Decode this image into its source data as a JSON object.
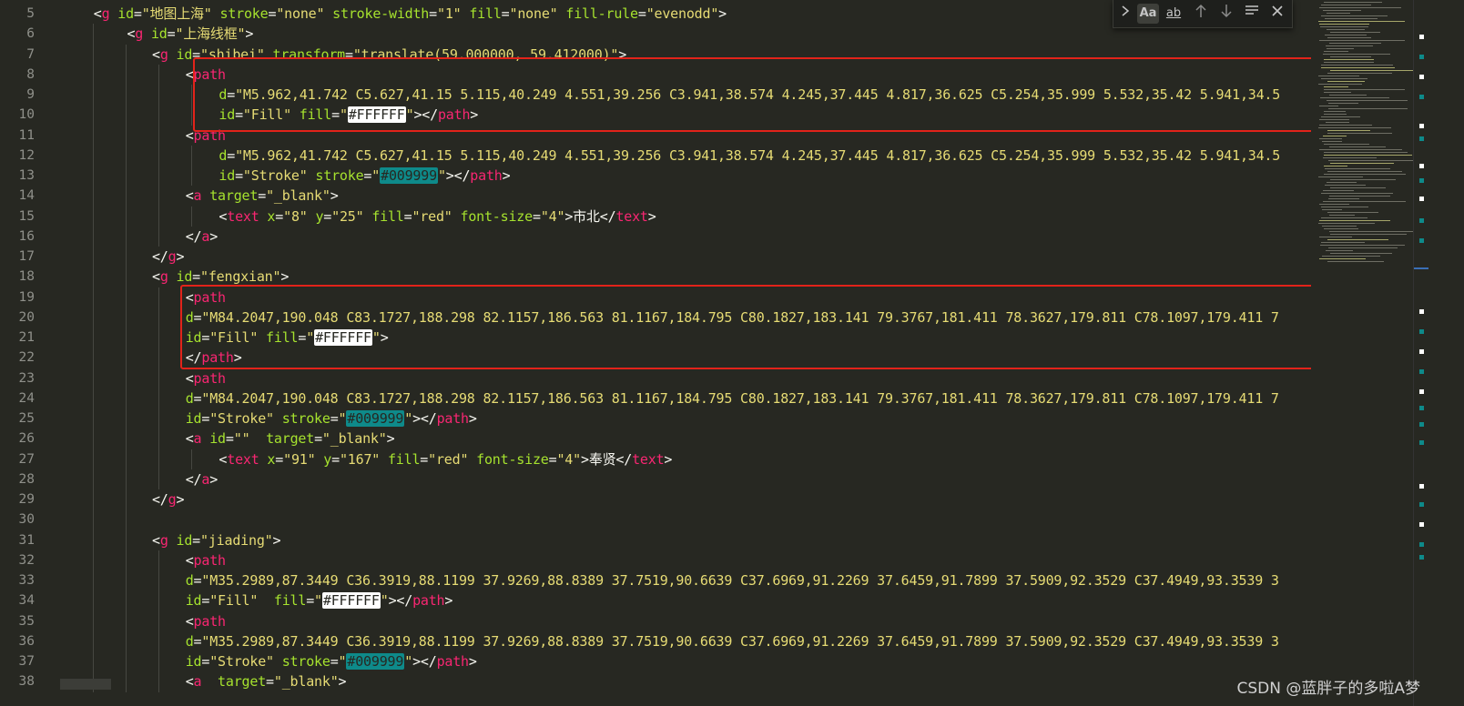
{
  "lines": [
    {
      "no": "5",
      "indent": "    ",
      "tokens": [
        [
          "p",
          "<"
        ],
        [
          "t",
          "g"
        ],
        [
          "c",
          " "
        ],
        [
          "a",
          "id"
        ],
        [
          "p",
          "="
        ],
        [
          "s",
          "\"地图上海\""
        ],
        [
          "c",
          " "
        ],
        [
          "a",
          "stroke"
        ],
        [
          "p",
          "="
        ],
        [
          "s",
          "\"none\""
        ],
        [
          "c",
          " "
        ],
        [
          "a",
          "stroke-width"
        ],
        [
          "p",
          "="
        ],
        [
          "s",
          "\"1\""
        ],
        [
          "c",
          " "
        ],
        [
          "a",
          "fill"
        ],
        [
          "p",
          "="
        ],
        [
          "s",
          "\"none\""
        ],
        [
          "c",
          " "
        ],
        [
          "a",
          "fill-rule"
        ],
        [
          "p",
          "="
        ],
        [
          "s",
          "\"evenodd\""
        ],
        [
          "p",
          ">"
        ]
      ]
    },
    {
      "no": "6",
      "indent": "        ",
      "tokens": [
        [
          "p",
          "<"
        ],
        [
          "t",
          "g"
        ],
        [
          "c",
          " "
        ],
        [
          "a",
          "id"
        ],
        [
          "p",
          "="
        ],
        [
          "s",
          "\"上海线框\""
        ],
        [
          "p",
          ">"
        ]
      ]
    },
    {
      "no": "7",
      "indent": "           ",
      "tokens": [
        [
          "p",
          "<"
        ],
        [
          "t",
          "g"
        ],
        [
          "c",
          " "
        ],
        [
          "a",
          "id"
        ],
        [
          "p",
          "="
        ],
        [
          "s",
          "\"shibei\""
        ],
        [
          "c",
          " "
        ],
        [
          "a",
          "transform"
        ],
        [
          "p",
          "="
        ],
        [
          "s",
          "\"translate(59.000000, 59.412000)\""
        ],
        [
          "p",
          ">"
        ]
      ]
    },
    {
      "no": "8",
      "indent": "               ",
      "tokens": [
        [
          "p",
          "<"
        ],
        [
          "t",
          "path"
        ]
      ]
    },
    {
      "no": "9",
      "indent": "                   ",
      "tokens": [
        [
          "a",
          "d"
        ],
        [
          "p",
          "="
        ],
        [
          "s",
          "\"M5.962,41.742 C5.627,41.15 5.115,40.249 4.551,39.256 C3.941,38.574 4.245,37.445 4.817,36.625 C5.254,35.999 5.532,35.42 5.941,34.5"
        ]
      ]
    },
    {
      "no": "10",
      "indent": "                   ",
      "tokens": [
        [
          "a",
          "id"
        ],
        [
          "p",
          "="
        ],
        [
          "s",
          "\"Fill\""
        ],
        [
          "c",
          " "
        ],
        [
          "a",
          "fill"
        ],
        [
          "p",
          "="
        ],
        [
          "s",
          "\""
        ],
        [
          "w",
          "#FFFFFF"
        ],
        [
          "s",
          "\""
        ],
        [
          "p",
          "></"
        ],
        [
          "t",
          "path"
        ],
        [
          "p",
          ">"
        ]
      ]
    },
    {
      "no": "11",
      "indent": "               ",
      "tokens": [
        [
          "p",
          "<"
        ],
        [
          "t",
          "path"
        ]
      ]
    },
    {
      "no": "12",
      "indent": "                   ",
      "tokens": [
        [
          "a",
          "d"
        ],
        [
          "p",
          "="
        ],
        [
          "s",
          "\"M5.962,41.742 C5.627,41.15 5.115,40.249 4.551,39.256 C3.941,38.574 4.245,37.445 4.817,36.625 C5.254,35.999 5.532,35.42 5.941,34.5"
        ]
      ]
    },
    {
      "no": "13",
      "indent": "                   ",
      "tokens": [
        [
          "a",
          "id"
        ],
        [
          "p",
          "="
        ],
        [
          "s",
          "\"Stroke\""
        ],
        [
          "c",
          " "
        ],
        [
          "a",
          "stroke"
        ],
        [
          "p",
          "="
        ],
        [
          "s",
          "\""
        ],
        [
          "tl",
          "#009999"
        ],
        [
          "s",
          "\""
        ],
        [
          "p",
          "></"
        ],
        [
          "t",
          "path"
        ],
        [
          "p",
          ">"
        ]
      ]
    },
    {
      "no": "14",
      "indent": "               ",
      "tokens": [
        [
          "p",
          "<"
        ],
        [
          "t",
          "a"
        ],
        [
          "c",
          " "
        ],
        [
          "a",
          "target"
        ],
        [
          "p",
          "="
        ],
        [
          "s",
          "\"_blank\""
        ],
        [
          "p",
          ">"
        ]
      ]
    },
    {
      "no": "15",
      "indent": "                   ",
      "tokens": [
        [
          "p",
          "<"
        ],
        [
          "t",
          "text"
        ],
        [
          "c",
          " "
        ],
        [
          "a",
          "x"
        ],
        [
          "p",
          "="
        ],
        [
          "s",
          "\"8\""
        ],
        [
          "c",
          " "
        ],
        [
          "a",
          "y"
        ],
        [
          "p",
          "="
        ],
        [
          "s",
          "\"25\""
        ],
        [
          "c",
          " "
        ],
        [
          "a",
          "fill"
        ],
        [
          "p",
          "="
        ],
        [
          "s",
          "\"red\""
        ],
        [
          "c",
          " "
        ],
        [
          "a",
          "font-size"
        ],
        [
          "p",
          "="
        ],
        [
          "s",
          "\"4\""
        ],
        [
          "p",
          ">"
        ],
        [
          "c",
          "市北"
        ],
        [
          "p",
          "</"
        ],
        [
          "t",
          "text"
        ],
        [
          "p",
          ">"
        ]
      ]
    },
    {
      "no": "16",
      "indent": "               ",
      "tokens": [
        [
          "p",
          "</"
        ],
        [
          "t",
          "a"
        ],
        [
          "p",
          ">"
        ]
      ]
    },
    {
      "no": "17",
      "indent": "           ",
      "tokens": [
        [
          "p",
          "</"
        ],
        [
          "t",
          "g"
        ],
        [
          "p",
          ">"
        ]
      ]
    },
    {
      "no": "18",
      "indent": "           ",
      "tokens": [
        [
          "p",
          "<"
        ],
        [
          "t",
          "g"
        ],
        [
          "c",
          " "
        ],
        [
          "a",
          "id"
        ],
        [
          "p",
          "="
        ],
        [
          "s",
          "\"fengxian\""
        ],
        [
          "p",
          ">"
        ]
      ]
    },
    {
      "no": "19",
      "indent": "               ",
      "tokens": [
        [
          "p",
          "<"
        ],
        [
          "t",
          "path"
        ]
      ]
    },
    {
      "no": "20",
      "indent": "               ",
      "tokens": [
        [
          "a",
          "d"
        ],
        [
          "p",
          "="
        ],
        [
          "s",
          "\"M84.2047,190.048 C83.1727,188.298 82.1157,186.563 81.1167,184.795 C80.1827,183.141 79.3767,181.411 78.3627,179.811 C78.1097,179.411 7"
        ]
      ]
    },
    {
      "no": "21",
      "indent": "               ",
      "tokens": [
        [
          "a",
          "id"
        ],
        [
          "p",
          "="
        ],
        [
          "s",
          "\"Fill\""
        ],
        [
          "c",
          " "
        ],
        [
          "a",
          "fill"
        ],
        [
          "p",
          "="
        ],
        [
          "s",
          "\""
        ],
        [
          "w",
          "#FFFFFF"
        ],
        [
          "s",
          "\""
        ],
        [
          "p",
          ">"
        ]
      ]
    },
    {
      "no": "22",
      "indent": "               ",
      "tokens": [
        [
          "p",
          "</"
        ],
        [
          "t",
          "path"
        ],
        [
          "p",
          ">"
        ]
      ]
    },
    {
      "no": "23",
      "indent": "               ",
      "tokens": [
        [
          "p",
          "<"
        ],
        [
          "t",
          "path"
        ]
      ]
    },
    {
      "no": "24",
      "indent": "               ",
      "tokens": [
        [
          "a",
          "d"
        ],
        [
          "p",
          "="
        ],
        [
          "s",
          "\"M84.2047,190.048 C83.1727,188.298 82.1157,186.563 81.1167,184.795 C80.1827,183.141 79.3767,181.411 78.3627,179.811 C78.1097,179.411 7"
        ]
      ]
    },
    {
      "no": "25",
      "indent": "               ",
      "tokens": [
        [
          "a",
          "id"
        ],
        [
          "p",
          "="
        ],
        [
          "s",
          "\"Stroke\""
        ],
        [
          "c",
          " "
        ],
        [
          "a",
          "stroke"
        ],
        [
          "p",
          "="
        ],
        [
          "s",
          "\""
        ],
        [
          "tl",
          "#009999"
        ],
        [
          "s",
          "\""
        ],
        [
          "p",
          "></"
        ],
        [
          "t",
          "path"
        ],
        [
          "p",
          ">"
        ]
      ]
    },
    {
      "no": "26",
      "indent": "               ",
      "tokens": [
        [
          "p",
          "<"
        ],
        [
          "t",
          "a"
        ],
        [
          "c",
          " "
        ],
        [
          "a",
          "id"
        ],
        [
          "p",
          "="
        ],
        [
          "s",
          "\"\""
        ],
        [
          "c",
          "  "
        ],
        [
          "a",
          "target"
        ],
        [
          "p",
          "="
        ],
        [
          "s",
          "\"_blank\""
        ],
        [
          "p",
          ">"
        ]
      ]
    },
    {
      "no": "27",
      "indent": "                   ",
      "tokens": [
        [
          "p",
          "<"
        ],
        [
          "t",
          "text"
        ],
        [
          "c",
          " "
        ],
        [
          "a",
          "x"
        ],
        [
          "p",
          "="
        ],
        [
          "s",
          "\"91\""
        ],
        [
          "c",
          " "
        ],
        [
          "a",
          "y"
        ],
        [
          "p",
          "="
        ],
        [
          "s",
          "\"167\""
        ],
        [
          "c",
          " "
        ],
        [
          "a",
          "fill"
        ],
        [
          "p",
          "="
        ],
        [
          "s",
          "\"red\""
        ],
        [
          "c",
          " "
        ],
        [
          "a",
          "font-size"
        ],
        [
          "p",
          "="
        ],
        [
          "s",
          "\"4\""
        ],
        [
          "p",
          ">"
        ],
        [
          "c",
          "奉贤"
        ],
        [
          "p",
          "</"
        ],
        [
          "t",
          "text"
        ],
        [
          "p",
          ">"
        ]
      ]
    },
    {
      "no": "28",
      "indent": "               ",
      "tokens": [
        [
          "p",
          "</"
        ],
        [
          "t",
          "a"
        ],
        [
          "p",
          ">"
        ]
      ]
    },
    {
      "no": "29",
      "indent": "           ",
      "tokens": [
        [
          "p",
          "</"
        ],
        [
          "t",
          "g"
        ],
        [
          "p",
          ">"
        ]
      ]
    },
    {
      "no": "30",
      "indent": "",
      "tokens": []
    },
    {
      "no": "31",
      "indent": "           ",
      "tokens": [
        [
          "p",
          "<"
        ],
        [
          "t",
          "g"
        ],
        [
          "c",
          " "
        ],
        [
          "a",
          "id"
        ],
        [
          "p",
          "="
        ],
        [
          "s",
          "\"jiading\""
        ],
        [
          "p",
          ">"
        ]
      ]
    },
    {
      "no": "32",
      "indent": "               ",
      "tokens": [
        [
          "p",
          "<"
        ],
        [
          "t",
          "path"
        ]
      ]
    },
    {
      "no": "33",
      "indent": "               ",
      "tokens": [
        [
          "a",
          "d"
        ],
        [
          "p",
          "="
        ],
        [
          "s",
          "\"M35.2989,87.3449 C36.3919,88.1199 37.9269,88.8389 37.7519,90.6639 C37.6969,91.2269 37.6459,91.7899 37.5909,92.3529 C37.4949,93.3539 3"
        ]
      ]
    },
    {
      "no": "34",
      "indent": "               ",
      "tokens": [
        [
          "a",
          "id"
        ],
        [
          "p",
          "="
        ],
        [
          "s",
          "\"Fill\""
        ],
        [
          "c",
          "  "
        ],
        [
          "a",
          "fill"
        ],
        [
          "p",
          "="
        ],
        [
          "s",
          "\""
        ],
        [
          "w",
          "#FFFFFF"
        ],
        [
          "s",
          "\""
        ],
        [
          "p",
          "></"
        ],
        [
          "t",
          "path"
        ],
        [
          "p",
          ">"
        ]
      ]
    },
    {
      "no": "35",
      "indent": "               ",
      "tokens": [
        [
          "p",
          "<"
        ],
        [
          "t",
          "path"
        ]
      ]
    },
    {
      "no": "36",
      "indent": "               ",
      "tokens": [
        [
          "a",
          "d"
        ],
        [
          "p",
          "="
        ],
        [
          "s",
          "\"M35.2989,87.3449 C36.3919,88.1199 37.9269,88.8389 37.7519,90.6639 C37.6969,91.2269 37.6459,91.7899 37.5909,92.3529 C37.4949,93.3539 3"
        ]
      ]
    },
    {
      "no": "37",
      "indent": "               ",
      "tokens": [
        [
          "a",
          "id"
        ],
        [
          "p",
          "="
        ],
        [
          "s",
          "\"Stroke\""
        ],
        [
          "c",
          " "
        ],
        [
          "a",
          "stroke"
        ],
        [
          "p",
          "="
        ],
        [
          "s",
          "\""
        ],
        [
          "tl",
          "#009999"
        ],
        [
          "s",
          "\""
        ],
        [
          "p",
          "></"
        ],
        [
          "t",
          "path"
        ],
        [
          "p",
          ">"
        ]
      ]
    },
    {
      "no": "38",
      "indent": "               ",
      "tokens": [
        [
          "p",
          "<"
        ],
        [
          "t",
          "a"
        ],
        [
          "c",
          "  "
        ],
        [
          "a",
          "target"
        ],
        [
          "p",
          "="
        ],
        [
          "s",
          "\"_blank\""
        ],
        [
          "p",
          ">"
        ]
      ]
    }
  ],
  "find_widget": {
    "toggle_icon": "chevron-right-icon",
    "match_case_label": "Aa",
    "whole_word_label": "ab",
    "prev_icon": "arrow-up-icon",
    "next_icon": "arrow-down-icon",
    "selection_icon": "menu-lines-icon",
    "close_icon": "close-icon"
  },
  "watermark": "CSDN @蓝胖子的多啦A梦",
  "colors": {
    "background": "#272822",
    "tag": "#f92672",
    "attribute": "#a6e22e",
    "string": "#e6db74",
    "highlight_box": "#e2231a",
    "white_match": "#ffffff",
    "teal_match": "#0e8a8a"
  }
}
